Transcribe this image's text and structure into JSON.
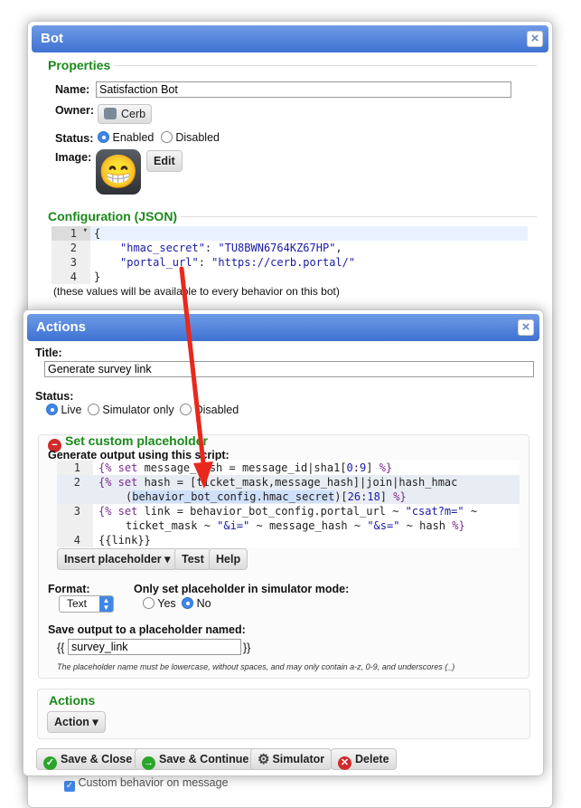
{
  "bot_dialog": {
    "title": "Bot",
    "close": "×",
    "properties_legend": "Properties",
    "name_label": "Name:",
    "name_value": "Satisfaction Bot",
    "owner_label": "Owner:",
    "owner_value": "Cerb",
    "status_label": "Status:",
    "status_enabled": "Enabled",
    "status_disabled": "Disabled",
    "image_label": "Image:",
    "image_edit": "Edit",
    "image_emoji": "😁",
    "config_legend": "Configuration (JSON)",
    "config_lines": [
      {
        "num": "1",
        "text": "{"
      },
      {
        "num": "2",
        "key": "\"hmac_secret\"",
        "val": "\"TU8BWN6764KZ67HP\"",
        "tail": ","
      },
      {
        "num": "3",
        "key": "\"portal_url\"",
        "val": "\"https://cerb.portal/\"",
        "tail": ""
      },
      {
        "num": "4",
        "text": "}"
      }
    ],
    "config_note": "(these values will be available to every behavior on this bot)",
    "custom_behavior_label": "Custom behavior on message"
  },
  "actions_dialog": {
    "title": "Actions",
    "close": "×",
    "title_label": "Title:",
    "title_value": "Generate survey link",
    "status_label": "Status:",
    "status_options": [
      "Live",
      "Simulator only",
      "Disabled"
    ],
    "section_title": "Set custom placeholder",
    "script_label": "Generate output using this script:",
    "code_lines": [
      {
        "num": "1"
      },
      {
        "num": "2"
      },
      {
        "num": "3"
      },
      {
        "num": "4"
      }
    ],
    "code": {
      "l1": [
        "{%",
        " set",
        " message_hash = message_id|sha1[",
        "0",
        ":",
        "9",
        "] ",
        "%}"
      ],
      "l2a": [
        "{%",
        " set",
        " hash = [ticket_mask,message_hash]|join|hash_hmac"
      ],
      "l2b": [
        "(",
        "behavior_bot_config.hmac_secret",
        ")[",
        "26",
        ":",
        "18",
        "] ",
        "%}"
      ],
      "l3a": [
        "{%",
        " set",
        " link = behavior_bot_config.portal_url ~ ",
        "\"csat?m=\"",
        " ~"
      ],
      "l3b": [
        "ticket_mask ~ ",
        "\"&i=\"",
        " ~ message_hash ~ ",
        "\"&s=\"",
        " ~ hash ",
        "%}"
      ],
      "l4": "{{link}}"
    },
    "insert_placeholder": "Insert placeholder ▾",
    "test_button": "Test",
    "help_button": "Help",
    "format_label": "Format:",
    "format_value": "Text",
    "simulator_label": "Only set placeholder in simulator mode:",
    "sim_yes": "Yes",
    "sim_no": "No",
    "save_output_label": "Save output to a placeholder named:",
    "placeholder_open": "{{",
    "placeholder_value": "survey_link",
    "placeholder_close": "}}",
    "placeholder_hint": "The placeholder name must be lowercase, without spaces, and may only contain a-z, 0-9, and underscores (_)",
    "actions_legend": "Actions",
    "action_button": "Action ▾",
    "footer_buttons": {
      "save_close": "Save & Close",
      "save_continue": "Save & Continue",
      "simulator": "Simulator",
      "delete": "Delete"
    }
  },
  "colors": {
    "titlebar": "#3e71d2",
    "legend_green": "#1a8a1a",
    "arrow_red": "#e8281c",
    "delete_red": "#d02b2b",
    "save_green": "#2aa52a"
  }
}
